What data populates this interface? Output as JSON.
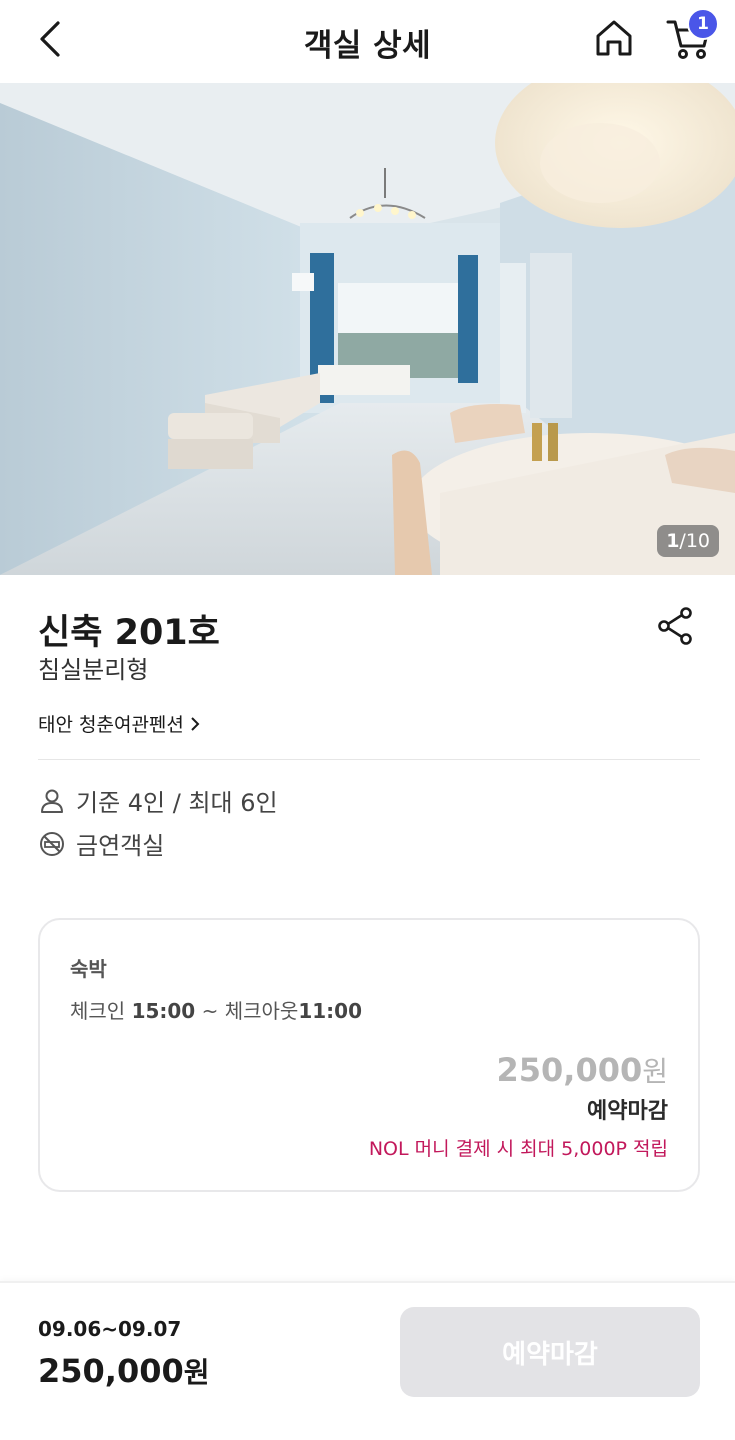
{
  "header": {
    "title": "객실 상세",
    "cart_count": "1"
  },
  "gallery": {
    "current": "1",
    "total": "/10"
  },
  "room": {
    "name": "신축 201호",
    "type": "침실분리형",
    "property": "태안 청춘여관펜션",
    "occupancy": "기준 4인 / 최대 6인",
    "smoking": "금연객실"
  },
  "stay": {
    "label": "숙박",
    "checkin_label": "체크인",
    "checkin_time": "15:00",
    "separator": "~",
    "checkout_label": "체크아웃",
    "checkout_time": "11:00",
    "price": "250,000",
    "currency": "원",
    "status": "예약마감",
    "promo": "NOL 머니 결제 시 최대 5,000P 적립"
  },
  "booking": {
    "dates": "09.06~09.07",
    "price": "250,000",
    "currency": "원",
    "button": "예약마감"
  },
  "colors": {
    "badge": "#4a56e8",
    "promo": "#c2185b",
    "disabled_button": "#e3e3e6"
  },
  "icons": [
    "back-arrow-icon",
    "home-icon",
    "cart-icon",
    "share-icon",
    "person-icon",
    "no-smoking-icon",
    "chevron-right-icon"
  ]
}
